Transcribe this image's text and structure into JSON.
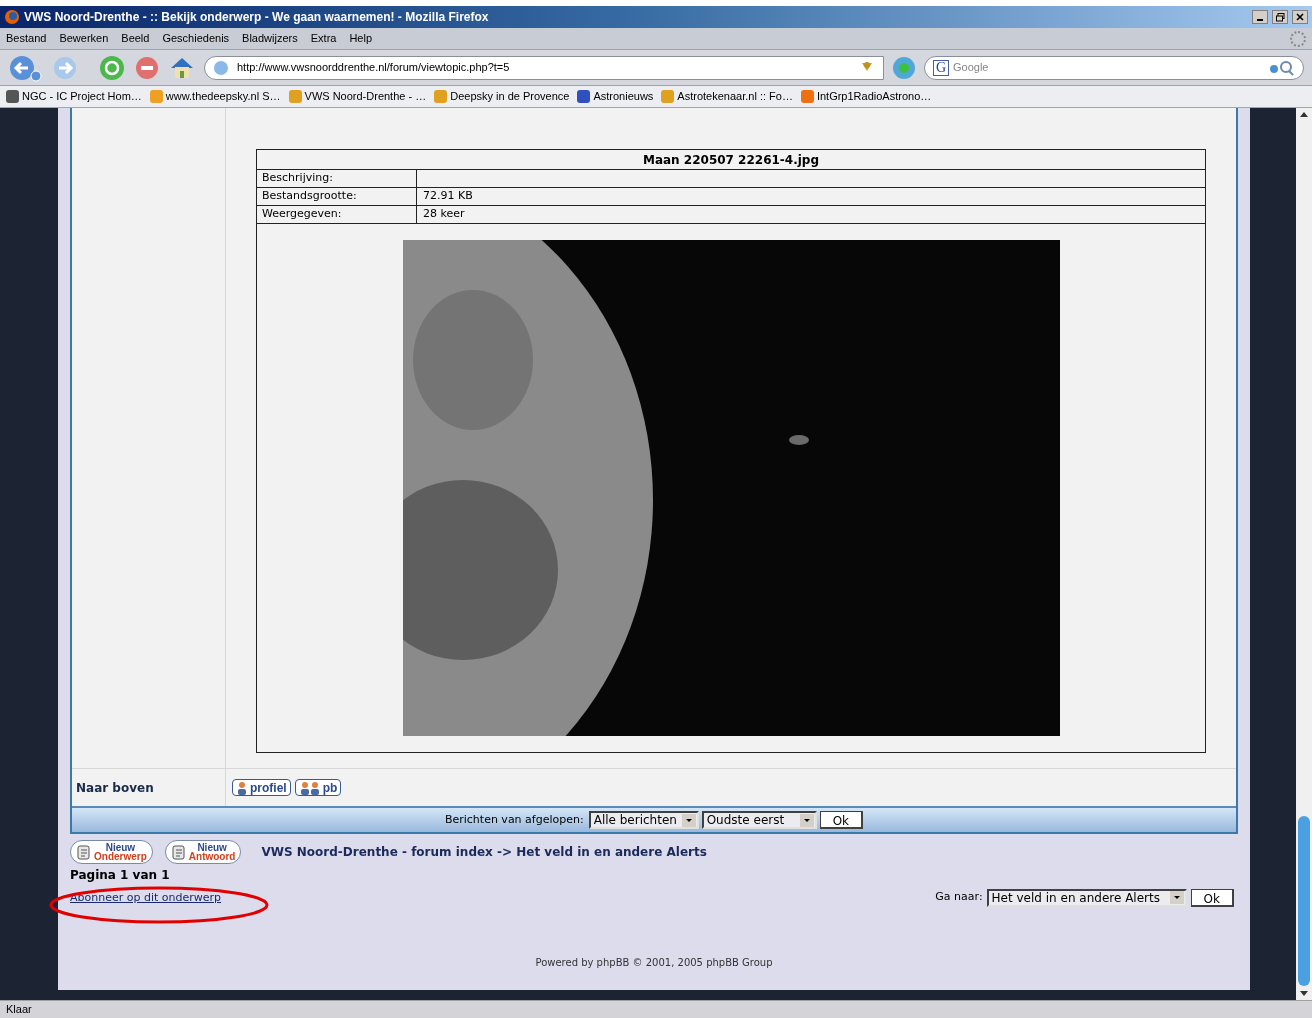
{
  "window": {
    "title": "VWS Noord-Drenthe - :: Bekijk onderwerp - We gaan waarnemen! - Mozilla Firefox"
  },
  "menu": [
    "Bestand",
    "Bewerken",
    "Beeld",
    "Geschiedenis",
    "Bladwijzers",
    "Extra",
    "Help"
  ],
  "address_bar": {
    "value": "http://www.vwsnoorddrenthe.nl/forum/viewtopic.php?t=5"
  },
  "search": {
    "engine_icon": "G",
    "placeholder": "Google"
  },
  "bookmarks": [
    {
      "label": "NGC - IC Project Hom…",
      "color": "#555555"
    },
    {
      "label": "www.thedeepsky.nl  S…",
      "color": "#f0a020"
    },
    {
      "label": "VWS Noord-Drenthe - …",
      "color": "#e0a020"
    },
    {
      "label": "Deepsky in de Provence",
      "color": "#e0a020"
    },
    {
      "label": "Astronieuws",
      "color": "#3050c0"
    },
    {
      "label": "Astrotekenaar.nl :: Fo…",
      "color": "#e0a020"
    },
    {
      "label": "IntGrp1RadioAstrono…",
      "color": "#f07010"
    }
  ],
  "attachment": {
    "title": "Maan 220507 22261-4.jpg",
    "rows": [
      {
        "label": "Beschrijving:",
        "value": ""
      },
      {
        "label": "Bestandsgrootte:",
        "value": "72.91 KB"
      },
      {
        "label": "Weergegeven:",
        "value": "28 keer"
      }
    ]
  },
  "post_footer": {
    "back_to_top": "Naar boven",
    "buttons": [
      "profiel",
      "pb"
    ]
  },
  "filter_bar": {
    "label": "Berichten van afgelopen:",
    "period": "Alle berichten",
    "order": "Oudste eerst",
    "ok": "Ok"
  },
  "actions": [
    {
      "top": "Nieuw",
      "bottom": "Onderwerp"
    },
    {
      "top": "Nieuw",
      "bottom": "Antwoord"
    }
  ],
  "breadcrumb": "VWS Noord-Drenthe - forum index -> Het veld in en andere Alerts",
  "pagination": "Pagina 1 van 1",
  "subscribe_link": "Abonneer op dit onderwerp",
  "jump": {
    "label": "Ga naar:",
    "value": "Het veld in en andere Alerts",
    "ok": "Ok"
  },
  "footer": "Powered by phpBB © 2001, 2005 phpBB Group",
  "status_bar": "Klaar"
}
